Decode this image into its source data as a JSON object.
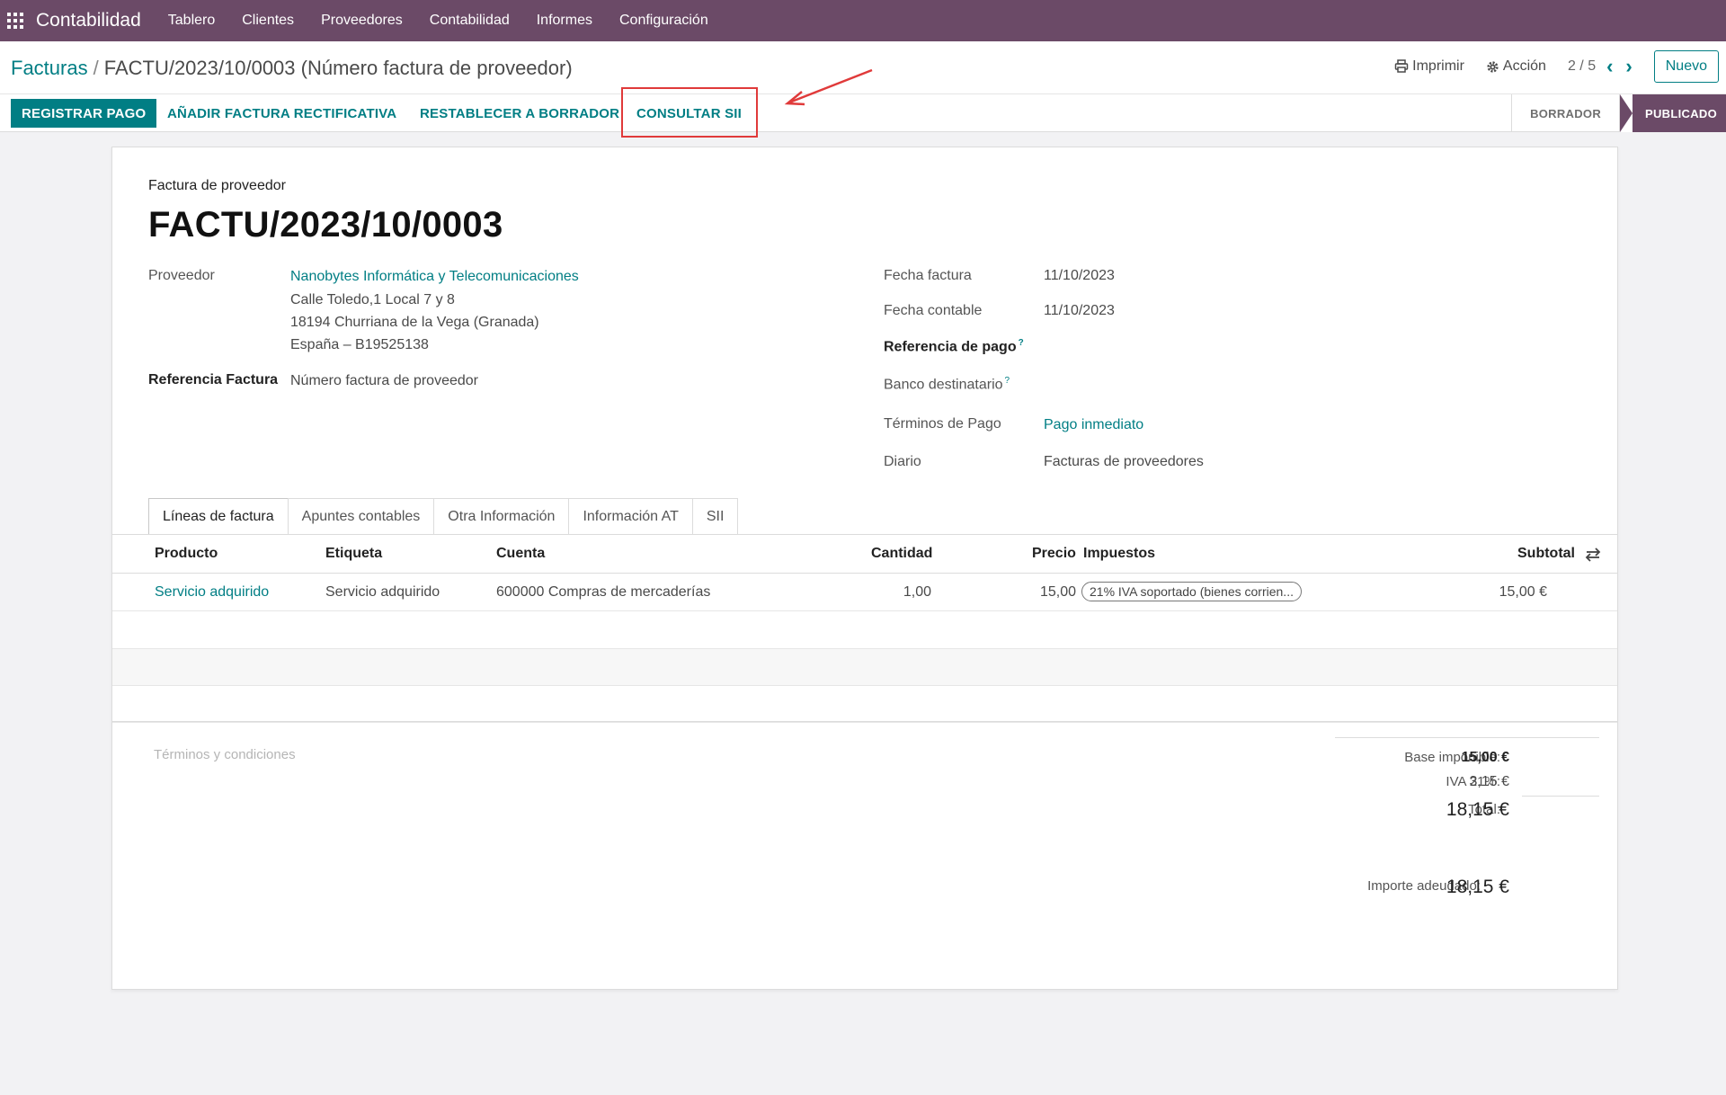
{
  "navbar": {
    "brand": "Contabilidad",
    "items": [
      "Tablero",
      "Clientes",
      "Proveedores",
      "Contabilidad",
      "Informes",
      "Configuración"
    ]
  },
  "breadcrumb": {
    "parent": "Facturas",
    "separator": "/",
    "current": "FACTU/2023/10/0003 (Número factura de proveedor)"
  },
  "control_panel": {
    "print_label": "Imprimir",
    "action_label": "Acción",
    "pager": "2 / 5",
    "new_label": "Nuevo"
  },
  "actions": {
    "register_payment": "REGISTRAR PAGO",
    "add_credit_note": "AÑADIR FACTURA RECTIFICATIVA",
    "reset_to_draft": "RESTABLECER A BORRADOR",
    "check_sii": "CONSULTAR SII"
  },
  "status": {
    "draft": "BORRADOR",
    "posted": "PUBLICADO",
    "active": "posted"
  },
  "form": {
    "doc_type": "Factura de proveedor",
    "title": "FACTU/2023/10/0003",
    "vendor_label": "Proveedor",
    "vendor_name": "Nanobytes Informática y Telecomunicaciones",
    "vendor_address1": "Calle Toledo,1 Local 7 y 8",
    "vendor_address2": "18194 Churriana de la Vega (Granada)",
    "vendor_address3": "España – B19525138",
    "bill_ref_label": "Referencia Factura",
    "bill_ref_value": "Número factura de proveedor",
    "invoice_date_label": "Fecha factura",
    "invoice_date": "11/10/2023",
    "accounting_date_label": "Fecha contable",
    "accounting_date": "11/10/2023",
    "payment_ref_label": "Referencia de pago",
    "bank_label": "Banco destinatario",
    "payment_terms_label": "Términos de Pago",
    "payment_terms": "Pago inmediato",
    "journal_label": "Diario",
    "journal": "Facturas de proveedores",
    "help_mark": "?"
  },
  "tabs": [
    "Líneas de factura",
    "Apuntes contables",
    "Otra Información",
    "Información AT",
    "SII"
  ],
  "lines": {
    "headers": {
      "product": "Producto",
      "label": "Etiqueta",
      "account": "Cuenta",
      "quantity": "Cantidad",
      "price": "Precio",
      "taxes": "Impuestos",
      "subtotal": "Subtotal"
    },
    "rows": [
      {
        "product": "Servicio adquirido",
        "label": "Servicio adquirido",
        "account": "600000 Compras de mercaderías",
        "quantity": "1,00",
        "price": "15,00",
        "tax": "21% IVA soportado (bienes corrien...",
        "subtotal": "15,00 €"
      }
    ]
  },
  "terms_placeholder": "Términos y condiciones",
  "totals": {
    "base_label": "Base imponible:",
    "base_value": "15,00 €",
    "vat_label": "IVA 21%:",
    "vat_value": "3,15 €",
    "total_label": "Total:",
    "total_value": "18,15 €",
    "due_label": "Importe adeudado:",
    "due_value": "18,15 €"
  },
  "colors": {
    "navbar": "#6b4a67",
    "primary": "#017e84",
    "annotation": "#e03a3a"
  }
}
